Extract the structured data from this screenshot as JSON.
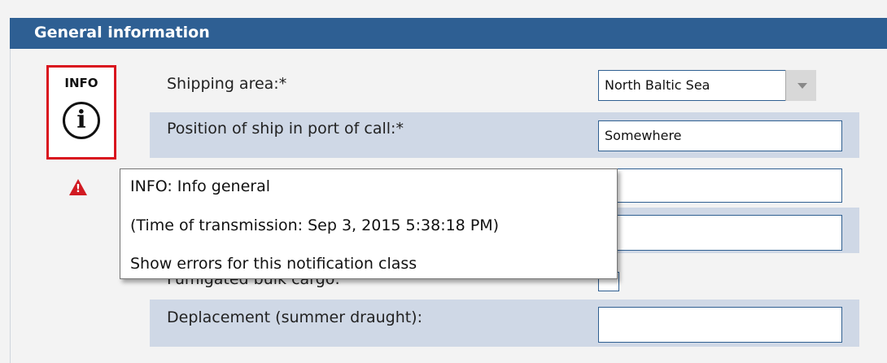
{
  "section": {
    "title": "General information"
  },
  "info_panel": {
    "label": "INFO",
    "icon": "info-circle-icon"
  },
  "warning": {
    "icon": "warning-triangle-icon",
    "glyph": "!"
  },
  "fields": {
    "shipping_area": {
      "label": "Shipping area:*",
      "value": "North Baltic Sea"
    },
    "position": {
      "label": "Position of ship in port of call:*",
      "value": "Somewhere"
    },
    "fumigated": {
      "label": "Fumigated bulk cargo:"
    },
    "deplacement": {
      "label": "Deplacement (summer draught):",
      "value": ""
    }
  },
  "tooltip": {
    "line1": "INFO: Info general",
    "line2": "(Time of transmission: Sep 3, 2015 5:38:18 PM)",
    "line3": "Show errors for this notification class"
  }
}
